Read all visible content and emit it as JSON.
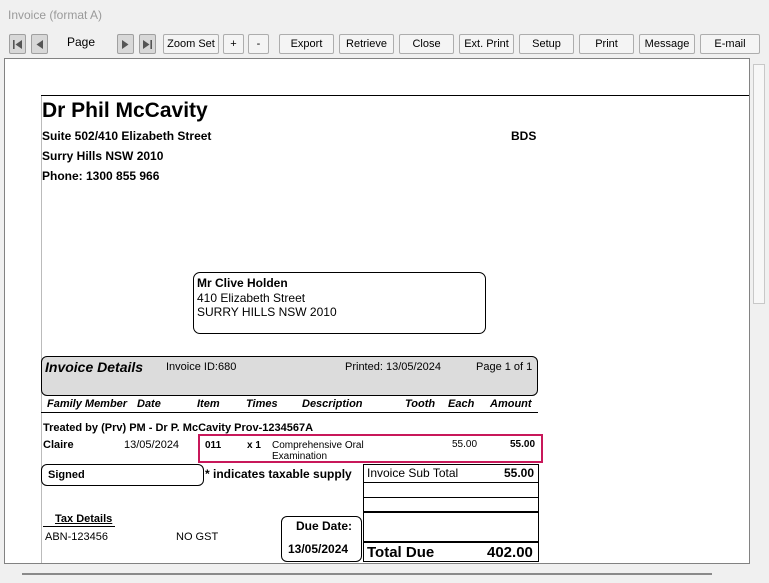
{
  "window": {
    "title": "Invoice (format A)"
  },
  "toolbar": {
    "page_label": "Page",
    "zoom_set": "Zoom Set",
    "zoom_in": "+",
    "zoom_out": "-",
    "export": "Export",
    "retrieve": "Retrieve",
    "close": "Close",
    "ext_print": "Ext. Print",
    "setup": "Setup",
    "print": "Print",
    "message": "Message",
    "email": "E-mail"
  },
  "practice": {
    "name": "Dr Phil McCavity",
    "address1": "Suite 502/410 Elizabeth Street",
    "address2": "Surry Hills NSW 2010",
    "phone": "Phone: 1300 855 966",
    "qualification": "BDS"
  },
  "recipient": {
    "name": "Mr Clive  Holden",
    "address1": "410 Elizabeth Street",
    "address2": "SURRY HILLS NSW 2010"
  },
  "invoice_header": {
    "title": "Invoice Details",
    "invoice_id": "Invoice ID:680",
    "printed": "Printed: 13/05/2024",
    "page": "Page 1 of 1"
  },
  "columns": {
    "family_member": "Family Member",
    "date": "Date",
    "item": "Item",
    "times": "Times",
    "description": "Description",
    "tooth": "Tooth",
    "each": "Each",
    "amount": "Amount"
  },
  "treated_by": "Treated by (Prv) PM - Dr P. McCavity Prov-1234567A",
  "line_item": {
    "patient": "Claire",
    "date": "13/05/2024",
    "item": "011",
    "times": "x  1",
    "description_line1": "Comprehensive Oral",
    "description_line2": "Examination",
    "each": "55.00",
    "amount": "55.00"
  },
  "signed_label": "Signed",
  "taxable_note": "* indicates taxable supply",
  "totals": {
    "subtotal_label": "Invoice Sub Total",
    "subtotal_value": "55.00",
    "total_due_label": "Total Due",
    "total_due_value": "402.00"
  },
  "tax_details": {
    "title": "Tax Details",
    "abn": "ABN-123456",
    "gst": "NO GST"
  },
  "due": {
    "label": "Due Date:",
    "date": "13/05/2024"
  },
  "colors": {
    "highlight": "#c8185a"
  }
}
